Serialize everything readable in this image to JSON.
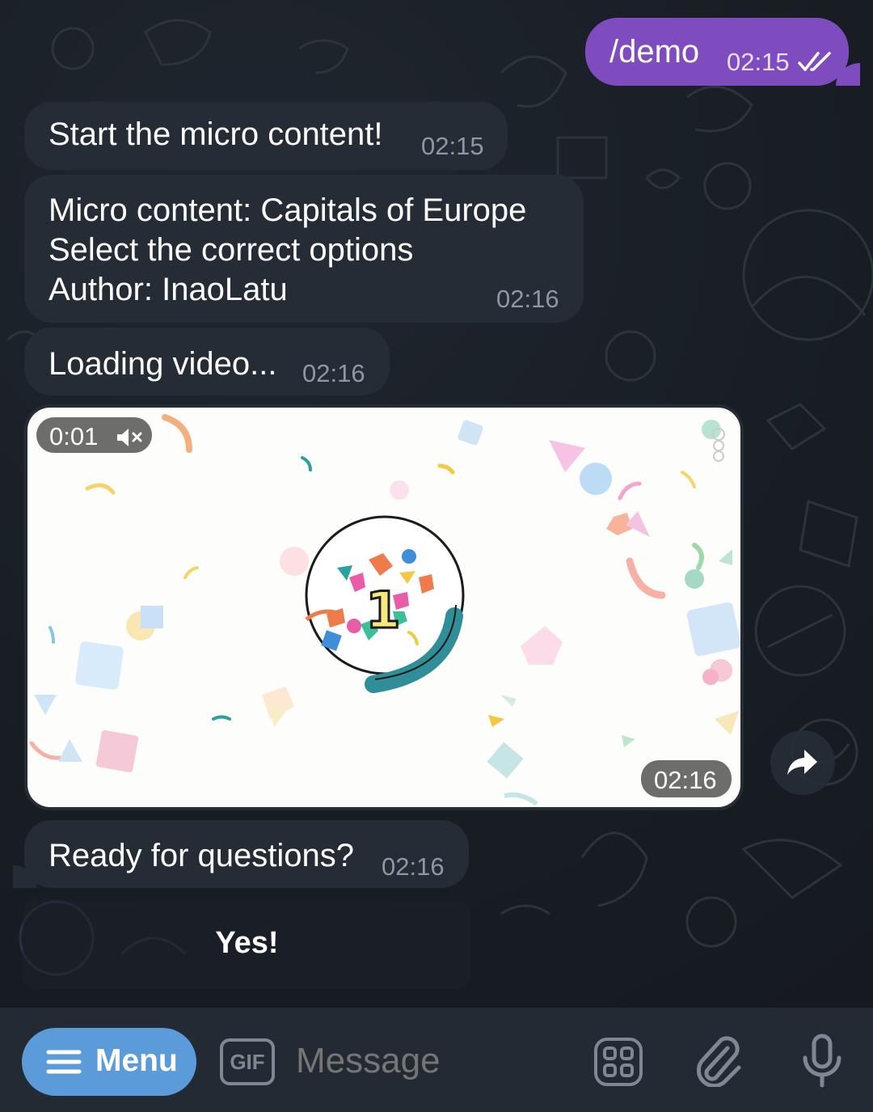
{
  "outgoing": {
    "text": "/demo",
    "time": "02:15",
    "status_icon": "double-check-icon"
  },
  "messages": [
    {
      "text": "Start the micro content!",
      "time": "02:15"
    },
    {
      "lines": [
        "Micro content: Capitals of Europe",
        "Select the correct options",
        "Author: InaoLatu"
      ],
      "time": "02:16"
    },
    {
      "text": "Loading video...",
      "time": "02:16"
    }
  ],
  "video": {
    "elapsed": "0:01",
    "muted_icon": "speaker-muted-icon",
    "time": "02:16",
    "center_number": "1"
  },
  "after_video": {
    "text": "Ready for questions?",
    "time": "02:16"
  },
  "keyboard": {
    "button_label": "Yes!"
  },
  "input_bar": {
    "menu_label": "Menu",
    "gif_label": "GIF",
    "placeholder": "Message",
    "icons": [
      "menu-icon",
      "emoji-grid-icon",
      "paperclip-icon",
      "microphone-icon"
    ]
  },
  "colors": {
    "outgoing": "#7f4cbf",
    "incoming": "#262c36",
    "menu_button": "#5b9bd9",
    "background": "#1a1f27"
  }
}
